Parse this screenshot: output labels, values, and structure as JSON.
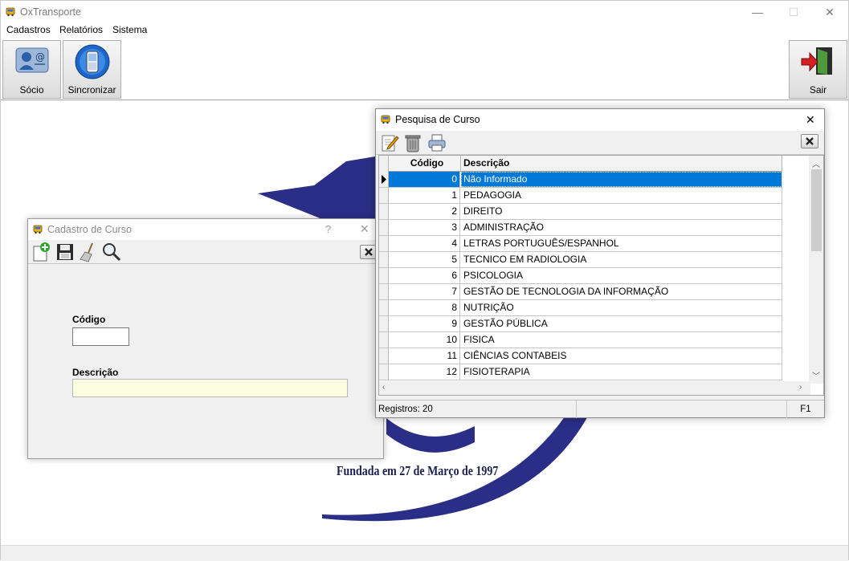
{
  "app": {
    "title": "OxTransporte",
    "window_controls": {
      "minimize": "—",
      "maximize": "☐",
      "close": "✕"
    }
  },
  "menu": [
    "Cadastros",
    "Relatórios",
    "Sistema"
  ],
  "toolbar": {
    "socio_label": "Sócio",
    "sincronizar_label": "Sincronizar",
    "sair_label": "Sair"
  },
  "background": {
    "caption": "Fundada em 27 de Março de 1997",
    "colors": {
      "logo_blue": "#2b2e86"
    }
  },
  "cadastro": {
    "title": "Cadastro de Curso",
    "help": "?",
    "close": "✕",
    "codigo_label": "Código",
    "codigo_value": "",
    "descricao_label": "Descrição",
    "descricao_value": "",
    "toolbar_icons": [
      "new-icon",
      "save-icon",
      "clear-broom-icon",
      "search-icon"
    ]
  },
  "pesquisa": {
    "title": "Pesquisa de Curso",
    "close": "✕",
    "columns": {
      "codigo": "Código",
      "descricao": "Descrição"
    },
    "rows": [
      {
        "codigo": "0",
        "descricao": "Não Informado"
      },
      {
        "codigo": "1",
        "descricao": "PEDAGOGIA"
      },
      {
        "codigo": "2",
        "descricao": "DIREITO"
      },
      {
        "codigo": "3",
        "descricao": "ADMINISTRAÇÃO"
      },
      {
        "codigo": "4",
        "descricao": "LETRAS PORTUGUÊS/ESPANHOL"
      },
      {
        "codigo": "5",
        "descricao": "TECNICO EM RADIOLOGIA"
      },
      {
        "codigo": "6",
        "descricao": "PSICOLOGIA"
      },
      {
        "codigo": "7",
        "descricao": "GESTÃO DE TECNOLOGIA DA INFORMAÇÃO"
      },
      {
        "codigo": "8",
        "descricao": "NUTRIÇÃO"
      },
      {
        "codigo": "9",
        "descricao": "GESTÃO PÚBLICA"
      },
      {
        "codigo": "10",
        "descricao": "FISICA"
      },
      {
        "codigo": "11",
        "descricao": "CIÊNCIAS CONTABEIS"
      },
      {
        "codigo": "12",
        "descricao": "FISIOTERAPIA"
      }
    ],
    "selected_row": 0,
    "status_registros": "Registros: 20",
    "status_key": "F1",
    "toolbar_icons": [
      "edit-icon",
      "trash-icon",
      "print-icon"
    ],
    "colors": {
      "selection": "#0078d7"
    }
  }
}
